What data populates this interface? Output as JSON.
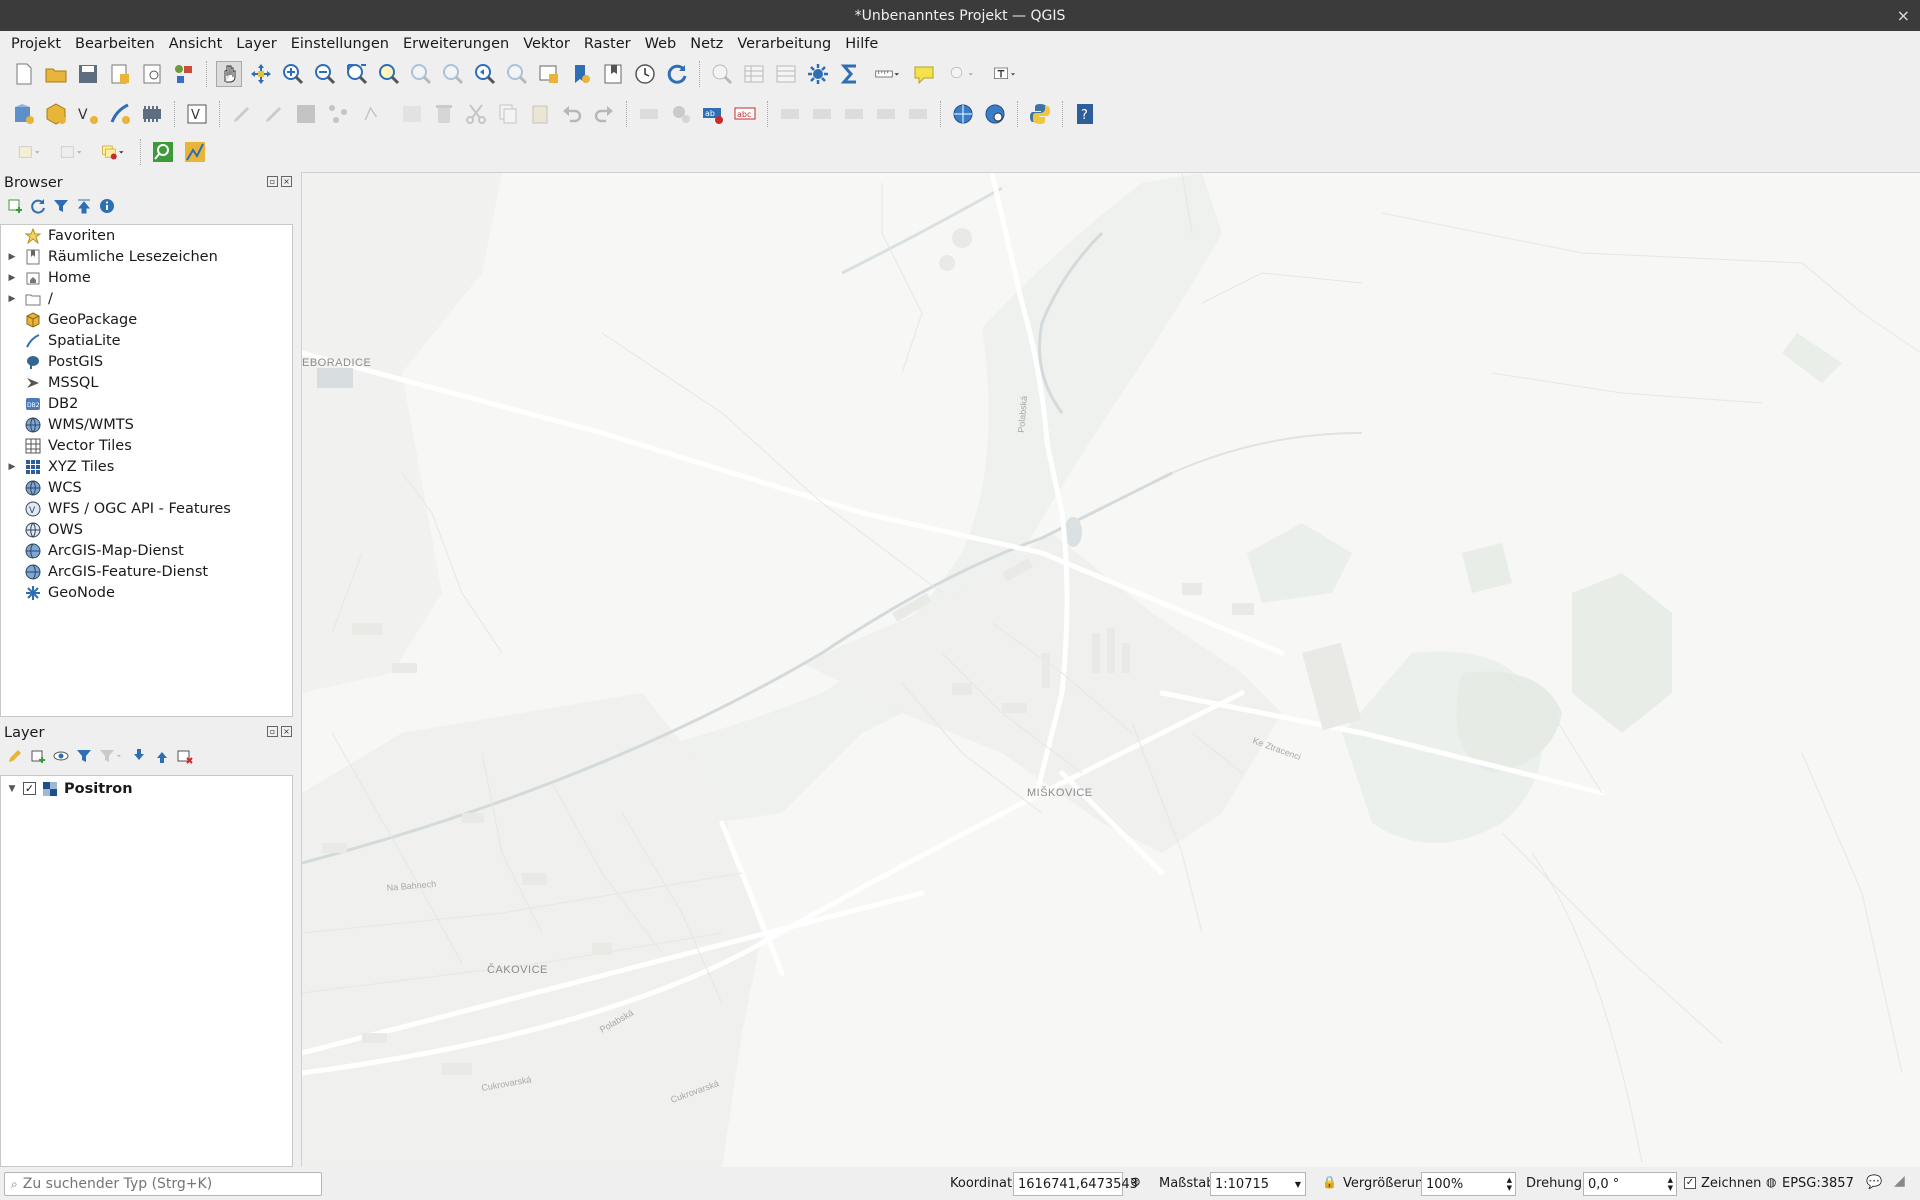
{
  "window": {
    "title": "*Unbenanntes Projekt — QGIS",
    "close_glyph": "×"
  },
  "menubar": {
    "items": [
      {
        "label": "Projekt"
      },
      {
        "label": "Bearbeiten"
      },
      {
        "label": "Ansicht"
      },
      {
        "label": "Layer"
      },
      {
        "label": "Einstellungen"
      },
      {
        "label": "Erweiterungen"
      },
      {
        "label": "Vektor"
      },
      {
        "label": "Raster"
      },
      {
        "label": "Web"
      },
      {
        "label": "Netz"
      },
      {
        "label": "Verarbeitung"
      },
      {
        "label": "Hilfe"
      }
    ]
  },
  "browser": {
    "title": "Browser",
    "items": [
      {
        "label": "Favoriten",
        "icon": "star-icon",
        "expandable": false
      },
      {
        "label": "Räumliche Lesezeichen",
        "icon": "bookmark-icon",
        "expandable": true
      },
      {
        "label": "Home",
        "icon": "home-folder-icon",
        "expandable": true
      },
      {
        "label": "/",
        "icon": "folder-icon",
        "expandable": true
      },
      {
        "label": "GeoPackage",
        "icon": "geopackage-icon",
        "expandable": false
      },
      {
        "label": "SpatiaLite",
        "icon": "spatialite-icon",
        "expandable": false
      },
      {
        "label": "PostGIS",
        "icon": "postgis-icon",
        "expandable": false
      },
      {
        "label": "MSSQL",
        "icon": "mssql-icon",
        "expandable": false
      },
      {
        "label": "DB2",
        "icon": "db2-icon",
        "expandable": false
      },
      {
        "label": "WMS/WMTS",
        "icon": "wms-globe-icon",
        "expandable": false
      },
      {
        "label": "Vector Tiles",
        "icon": "vector-tiles-icon",
        "expandable": false
      },
      {
        "label": "XYZ Tiles",
        "icon": "xyz-tiles-icon",
        "expandable": true
      },
      {
        "label": "WCS",
        "icon": "wcs-globe-icon",
        "expandable": false
      },
      {
        "label": "WFS / OGC API - Features",
        "icon": "wfs-icon",
        "expandable": false
      },
      {
        "label": "OWS",
        "icon": "ows-globe-icon",
        "expandable": false
      },
      {
        "label": "ArcGIS-Map-Dienst",
        "icon": "arcgis-map-icon",
        "expandable": false
      },
      {
        "label": "ArcGIS-Feature-Dienst",
        "icon": "arcgis-feature-icon",
        "expandable": false
      },
      {
        "label": "GeoNode",
        "icon": "geonode-icon",
        "expandable": false
      }
    ]
  },
  "layers": {
    "title": "Layer",
    "items": [
      {
        "label": "Positron",
        "checked": true,
        "icon": "xyz-layer-icon"
      }
    ]
  },
  "map": {
    "labels": [
      {
        "text": "EBORADICE"
      },
      {
        "text": "MIŠKOVICE"
      },
      {
        "text": "ČAKOVICE"
      },
      {
        "text": "Polabská"
      },
      {
        "text": "Cukrovarská"
      },
      {
        "text": "Ke Ztracenci"
      },
      {
        "text": "Na Bahnech"
      },
      {
        "text": "Polabská"
      },
      {
        "text": "Cukrovarská"
      }
    ]
  },
  "statusbar": {
    "search_placeholder": "Zu suchender Typ (Strg+K)",
    "coordinate_label": "Koordinate",
    "coordinate_value": "1616741,6473543",
    "scale_label": "Maßstab",
    "scale_value": "1:10715",
    "magnifier_label": "Vergrößerung",
    "magnifier_value": "100%",
    "rotation_label": "Drehung",
    "rotation_value": "0,0 °",
    "render_label": "Zeichnen",
    "crs_value": "EPSG:3857"
  },
  "colors": {
    "titlebar": "#3b3b3b",
    "panel": "#efefef",
    "map_bg": "#f7f7f5",
    "road": "#ffffff",
    "green": "#e6ece6",
    "water": "#d6dedf"
  }
}
